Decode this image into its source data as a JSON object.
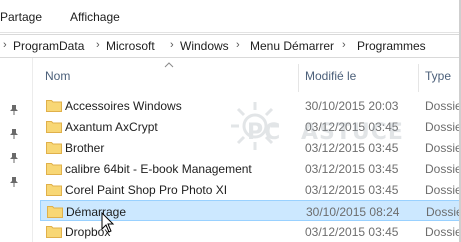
{
  "ribbon": {
    "tabs": [
      "Partage",
      "Affichage"
    ]
  },
  "address_bar": {
    "crumbs": [
      "ProgramData",
      "Microsoft",
      "Windows",
      "Menu Démarrer",
      "Programmes"
    ]
  },
  "columns": {
    "name": "Nom",
    "modified": "Modifié le",
    "type": "Type"
  },
  "files": [
    {
      "name": "Accessoires Windows",
      "date": "30/10/2015 20:03",
      "type": "Dossie"
    },
    {
      "name": "Axantum AxCrypt",
      "date": "03/12/2015 03:45",
      "type": "Dossie"
    },
    {
      "name": "Brother",
      "date": "03/12/2015 03:45",
      "type": "Dossie"
    },
    {
      "name": "calibre 64bit - E-book Management",
      "date": "03/12/2015 03:45",
      "type": "Dossie"
    },
    {
      "name": "Corel Paint Shop Pro Photo XI",
      "date": "03/12/2015 03:45",
      "type": "Dossie"
    },
    {
      "name": "Démarrage",
      "date": "30/10/2015 08:24",
      "type": "Dossie",
      "selected": true
    },
    {
      "name": "Dropbox",
      "date": "03/12/2015 03:45",
      "type": "Dossie"
    }
  ],
  "watermark": {
    "text": "PC ASTUCES"
  },
  "colors": {
    "selection_bg": "#cce8ff",
    "selection_border": "#99d1ff",
    "folder_yellow": "#f8d775",
    "header_text": "#4c607a"
  },
  "icons": {
    "folder": "folder-icon",
    "pin": "pin-icon",
    "sort": "sort-up-icon",
    "chevron": "chevron-right-icon"
  }
}
